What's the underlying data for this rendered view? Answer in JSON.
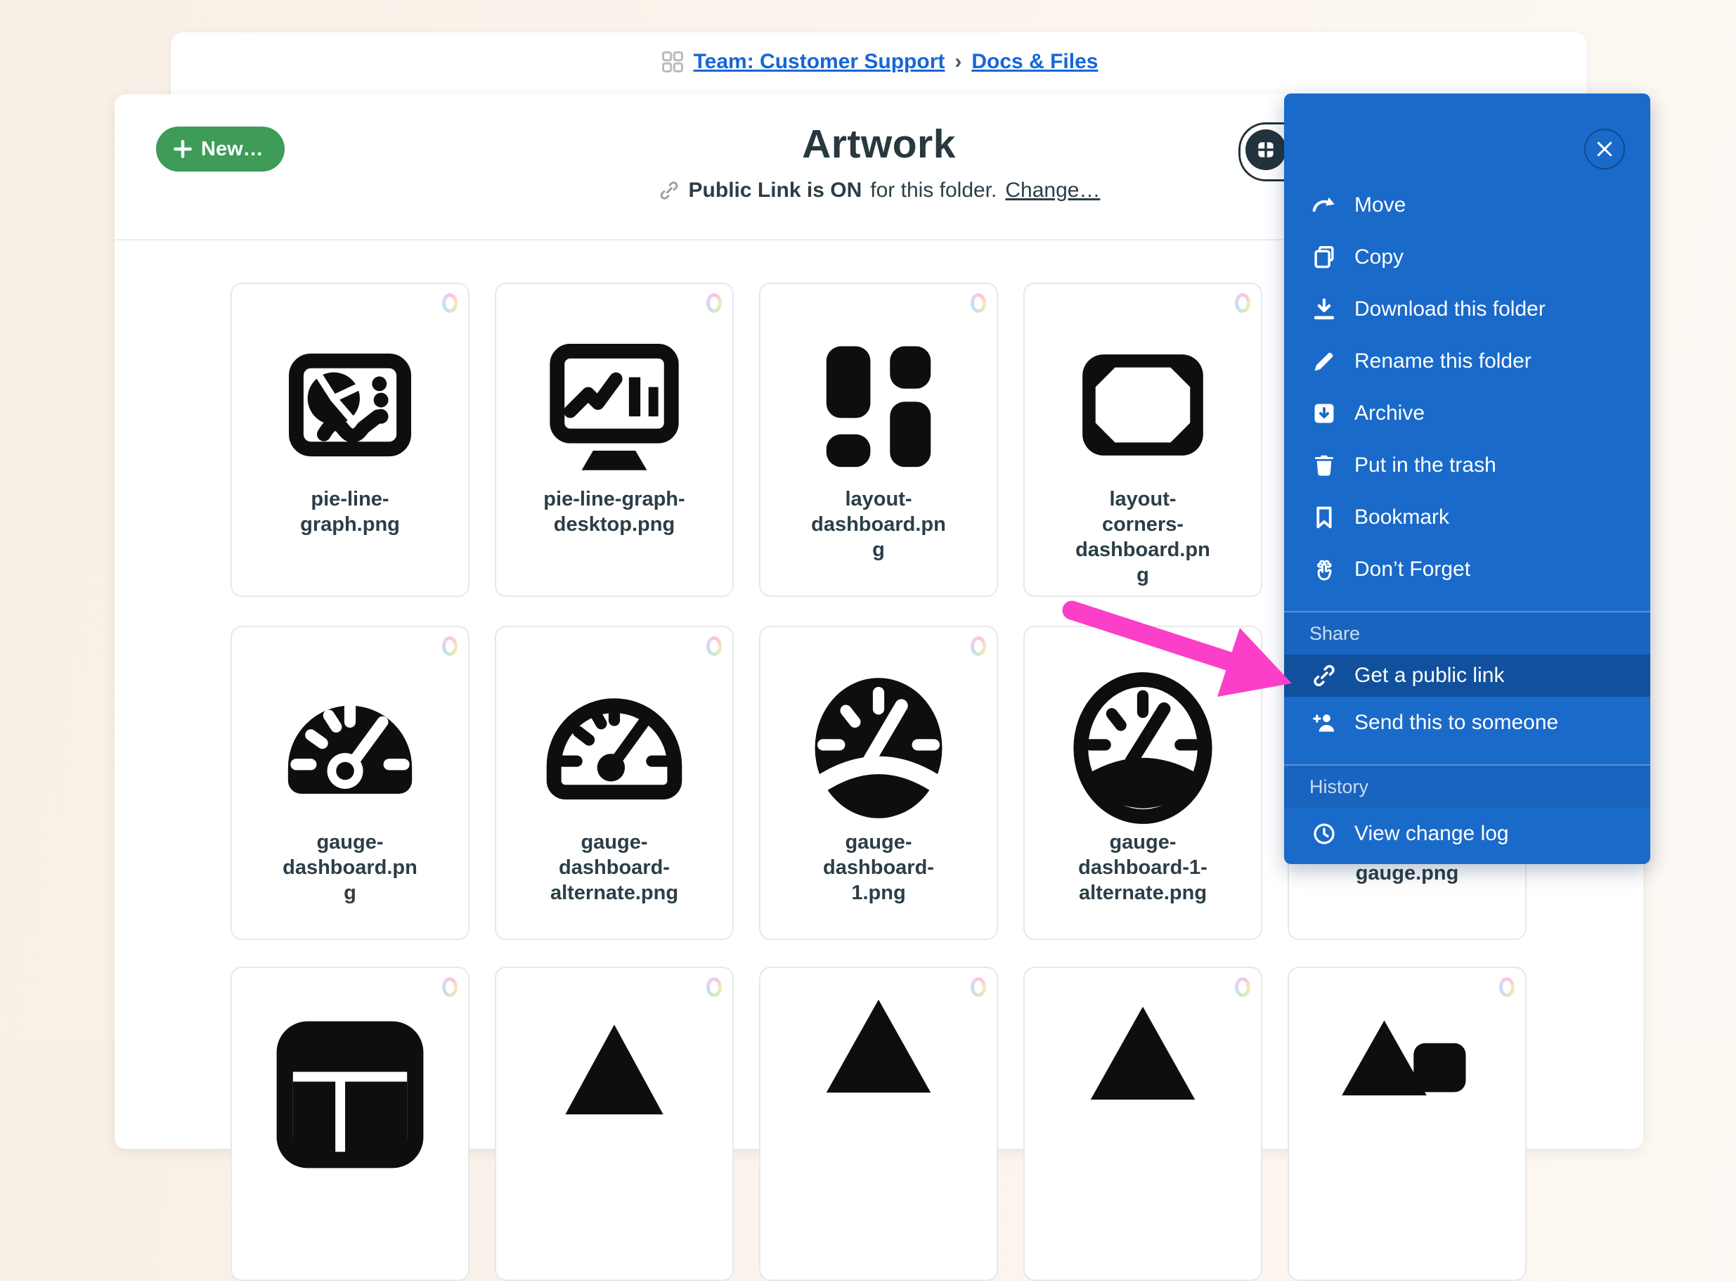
{
  "colors": {
    "panel_blue": "#1a6ac9",
    "panel_highlight": "#11509c",
    "new_button_green": "#3e9b58",
    "link_blue": "#1566d8",
    "ink": "#2c3e47",
    "arrow_pink": "#fb3fc8"
  },
  "breadcrumb": {
    "grid_icon": "grid-icon",
    "team": "Team: Customer Support",
    "separator": "›",
    "section": "Docs & Files"
  },
  "header": {
    "new_button": "New…",
    "title": "Artwork",
    "link_icon": "link-icon",
    "public_link_bold": "Public Link is ON",
    "public_link_rest": "for this folder.",
    "change_link": "Change…",
    "view_toggle_icon": "grid-view-icon"
  },
  "panel": {
    "close_icon": "close-icon",
    "groups": [
      {
        "items": [
          {
            "icon": "move-icon",
            "label": "Move"
          },
          {
            "icon": "copy-icon",
            "label": "Copy"
          },
          {
            "icon": "download-icon",
            "label": "Download this folder"
          },
          {
            "icon": "pencil-icon",
            "label": "Rename this folder"
          },
          {
            "icon": "archive-icon",
            "label": "Archive"
          },
          {
            "icon": "trash-icon",
            "label": "Put in the trash"
          },
          {
            "icon": "bookmark-icon",
            "label": "Bookmark"
          },
          {
            "icon": "dont-forget-icon",
            "label": "Don’t Forget"
          }
        ]
      },
      {
        "header": "Share",
        "items": [
          {
            "icon": "public-link-icon",
            "label": "Get a public link",
            "highlighted": true
          },
          {
            "icon": "send-person-icon",
            "label": "Send this to someone"
          }
        ]
      },
      {
        "header": "History",
        "items": [
          {
            "icon": "clock-icon",
            "label": "View change log"
          }
        ]
      }
    ]
  },
  "files": {
    "rows": [
      {
        "items": [
          {
            "filename": "pie-line-graph.png",
            "icon": "pie-line-graph-icon"
          },
          {
            "filename": "pie-line-graph-desktop.png",
            "icon": "desktop-graph-icon"
          },
          {
            "filename": "layout-dashboard.png",
            "icon": "layout-dashboard-icon"
          },
          {
            "filename": "layout-corners-dashboard.png",
            "icon": "layout-corners-icon"
          }
        ]
      },
      {
        "items": [
          {
            "filename": "gauge-dashboard.png",
            "icon": "gauge-solid-icon"
          },
          {
            "filename": "gauge-dashboard-alternate.png",
            "icon": "gauge-outline-icon"
          },
          {
            "filename": "gauge-dashboard-1.png",
            "icon": "gauge-round-solid-icon"
          },
          {
            "filename": "gauge-dashboard-1-alternate.png",
            "icon": "gauge-round-outline-icon"
          },
          {
            "filename": "gauge.png",
            "icon": "hidden-behind-panel"
          }
        ]
      },
      {
        "items": [
          {
            "icon": "window-top-icon"
          },
          {
            "icon": "mountain-small-icon"
          },
          {
            "icon": "mountain-icon"
          },
          {
            "icon": "mountain-icon"
          },
          {
            "icon": "photo-mountain-icon"
          }
        ]
      }
    ]
  }
}
